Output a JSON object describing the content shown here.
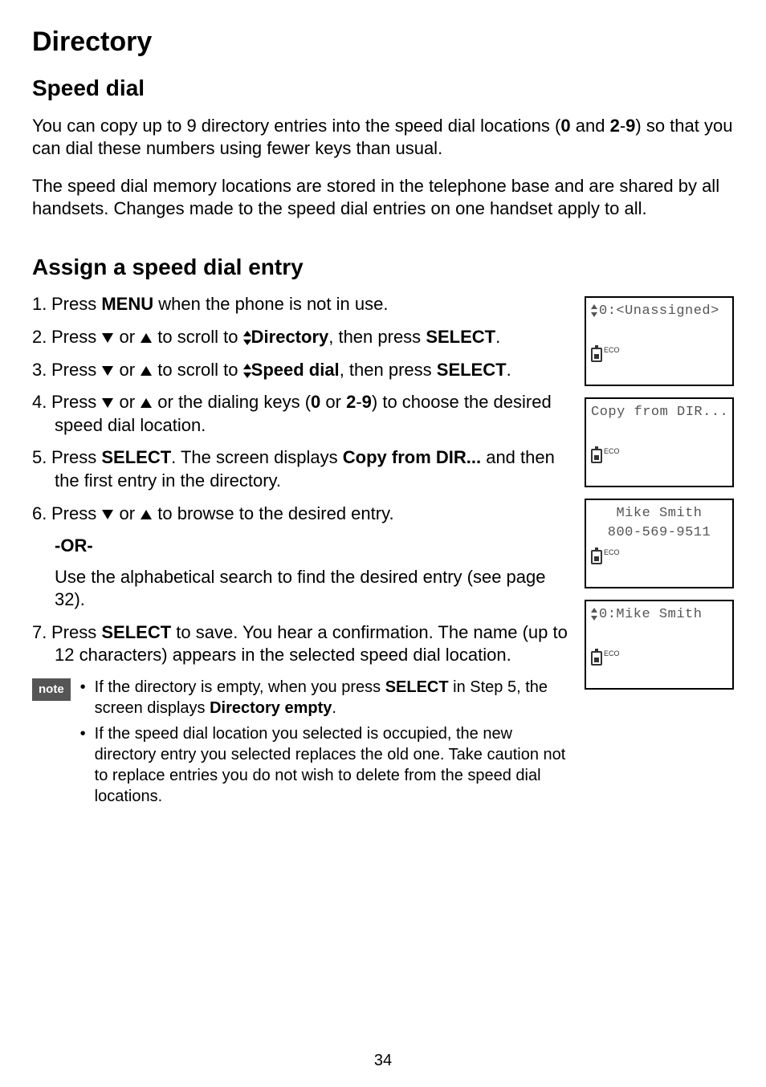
{
  "page": {
    "title": "Directory",
    "section": "Speed dial",
    "intro1_pre": "You can copy up to 9 directory entries into the speed dial locations (",
    "intro1_b1": "0",
    "intro1_mid": " and ",
    "intro1_b2": "2",
    "intro1_dash": "-",
    "intro1_b3": "9",
    "intro1_post": ") so that you can dial these numbers using fewer keys than usual.",
    "intro2": "The speed dial memory locations are stored in the telephone base and are shared by all handsets. Changes made to the speed dial entries on one handset apply to all.",
    "assign_heading": "Assign a speed dial entry",
    "step1_pre": "Press ",
    "step1_b1": "MENU",
    "step1_post": " when the phone is not in use.",
    "step2_pre": "Press ",
    "step2_mid1": " or ",
    "step2_mid2": " to scroll to ",
    "step2_b1": "Directory",
    "step2_mid3": ", then press ",
    "step2_b2": "SELECT",
    "step2_post": ".",
    "step3_pre": "Press ",
    "step3_mid1": " or ",
    "step3_mid2": " to scroll to ",
    "step3_b1": "Speed dial",
    "step3_mid3": ", then press ",
    "step3_b2": "SELECT",
    "step3_post": ".",
    "step4_pre": "Press ",
    "step4_mid1": " or ",
    "step4_mid2": " or the dialing keys (",
    "step4_b1": "0",
    "step4_mid3": " or ",
    "step4_b2": "2",
    "step4_dash": "-",
    "step4_b3": "9",
    "step4_post": ") to choose the desired speed dial location.",
    "step5_pre": "Press ",
    "step5_b1": "SELECT",
    "step5_mid1": ". The screen displays ",
    "step5_b2": "Copy from DIR...",
    "step5_post": " and then the first entry in the directory.",
    "step6_pre": "Press ",
    "step6_mid1": " or ",
    "step6_post": " to browse to the desired entry.",
    "or_label": "-OR-",
    "step6_alt": "Use the alphabetical search to find the desired entry (see page 32).",
    "step7_pre": "Press ",
    "step7_b1": "SELECT",
    "step7_post": " to save. You hear a confirmation. The name (up to 12 characters) appears in the selected speed dial location.",
    "note_label": "note",
    "note1_pre": "If the directory is empty, when you press ",
    "note1_b1": "SELECT",
    "note1_mid": " in Step 5, the screen displays ",
    "note1_b2": "Directory empty",
    "note1_post": ".",
    "note2": "If the speed dial location you selected is occupied, the new directory entry you selected replaces the old one. Take caution not to replace entries you do not wish to delete from the speed dial locations.",
    "page_number": "34"
  },
  "lcd": {
    "eco_label": "ECO",
    "screen1_line1": "0:<Unassigned>",
    "screen2_line1": "Copy from DIR...",
    "screen3_line1": "Mike Smith",
    "screen3_line2": "800-569-9511",
    "screen4_line1": "0:Mike Smith"
  }
}
